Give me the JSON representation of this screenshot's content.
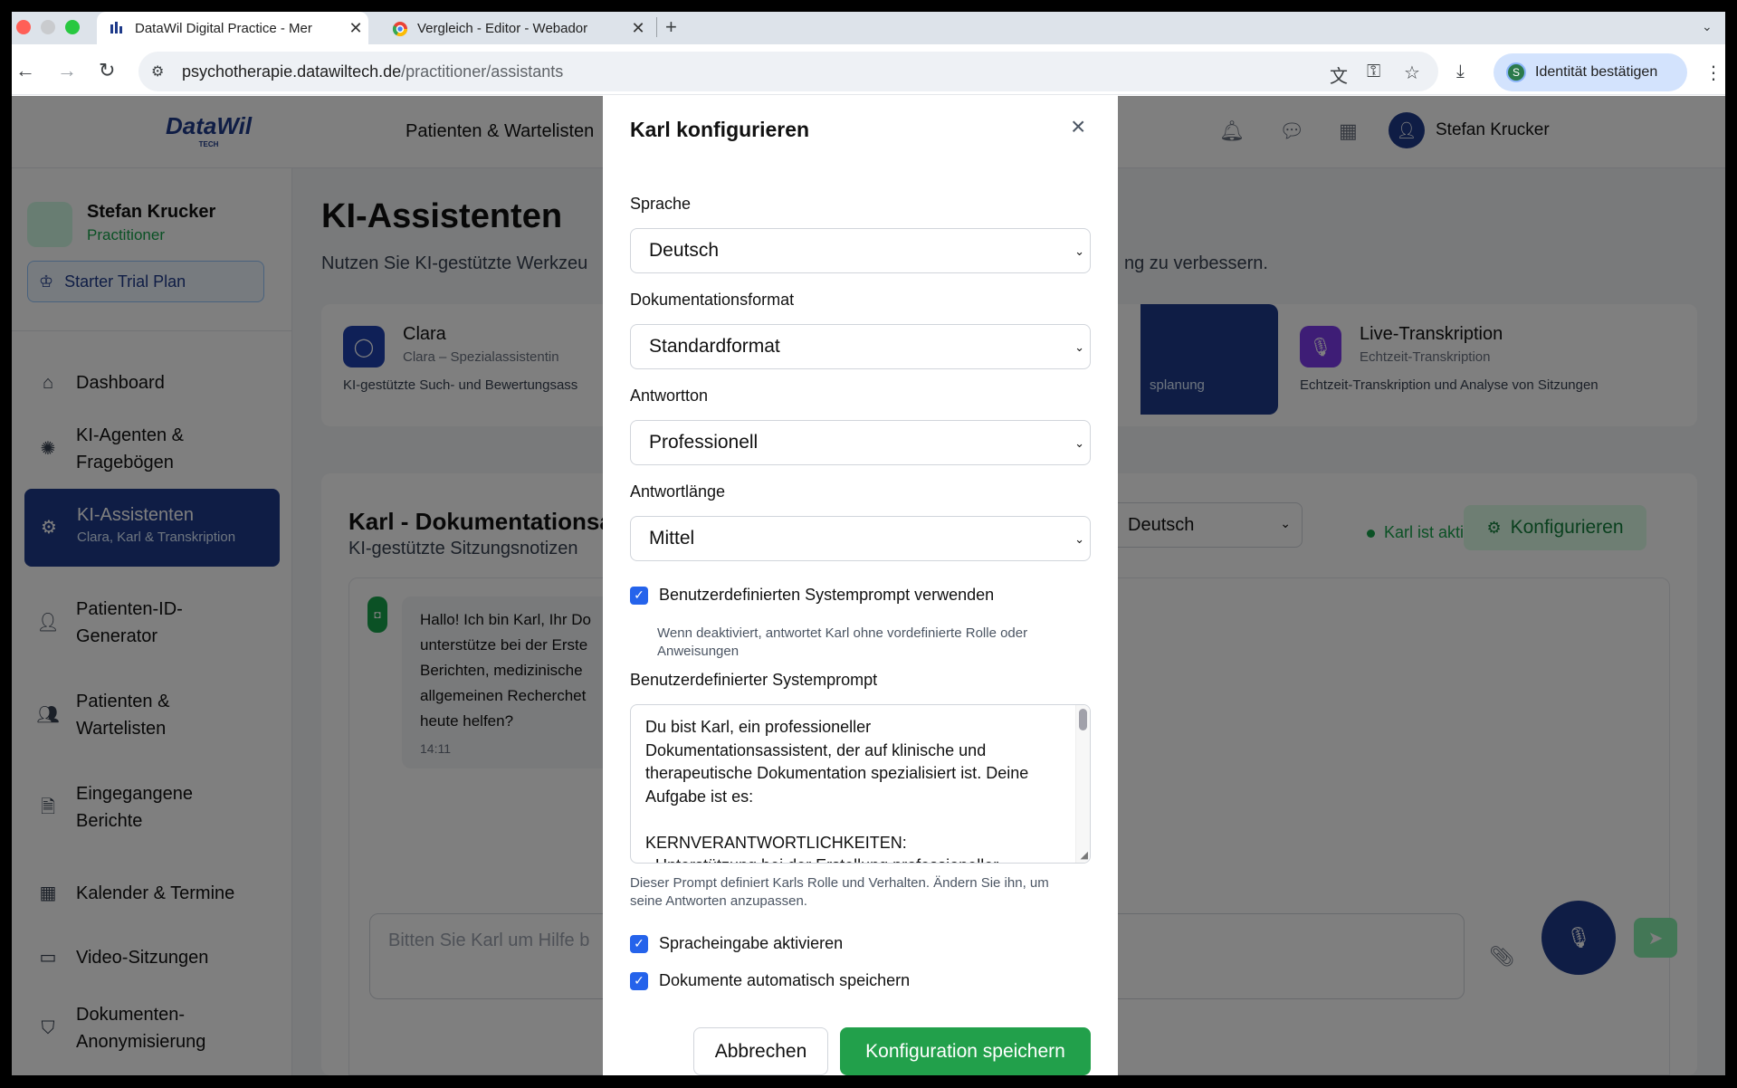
{
  "browser": {
    "tabs": [
      {
        "title": "DataWil Digital Practice - Mer",
        "active": true
      },
      {
        "title": "Vergleich - Editor - Webador",
        "active": false
      }
    ],
    "new_tab": "+",
    "url_host": "psychotherapie.datawiltech.de",
    "url_path": "/practitioner/assistants",
    "identity_button": "Identität bestätigen",
    "identity_initial": "S"
  },
  "app": {
    "logo": "DataWil",
    "logo_sub": "TECH",
    "header_nav": "Patienten & Wartelisten",
    "header_user": "Stefan Krucker"
  },
  "sidebar": {
    "user_name": "Stefan Krucker",
    "user_role": "Practitioner",
    "plan": "Starter Trial Plan",
    "items": [
      {
        "label": "Dashboard",
        "icon": "home-icon"
      },
      {
        "label": "KI-Agenten &\nFragebögen",
        "icon": "brain-icon"
      },
      {
        "label": "KI-Assistenten",
        "sub": "Clara, Karl & Transkription",
        "icon": "robot-icon",
        "active": true
      },
      {
        "label": "Patienten-ID-\nGenerator",
        "icon": "user-icon"
      },
      {
        "label": "Patienten &\nWartelisten",
        "icon": "users-icon"
      },
      {
        "label": "Eingegangene\nBerichte",
        "icon": "document-icon"
      },
      {
        "label": "Kalender & Termine",
        "icon": "calendar-icon"
      },
      {
        "label": "Video-Sitzungen",
        "icon": "video-icon"
      },
      {
        "label": "Dokumenten-\nAnonymisierung",
        "icon": "shield-icon"
      }
    ]
  },
  "main": {
    "title": "KI-Assistenten",
    "lead_left": "Nutzen Sie KI-gestützte Werkzeu",
    "lead_right": "ng zu verbessern.",
    "assistants": [
      {
        "name": "Clara",
        "sub": "Clara – Spezialassistentin",
        "desc": "KI-gestützte Such- und Bewertungsass"
      },
      {
        "name": "Live-Transkription",
        "sub": "Echtzeit-Transkription",
        "desc": "Echtzeit-Transkription und Analyse von Sitzungen"
      }
    ],
    "karl_card_fragment": "splanung",
    "karl_title": "Karl - Dokumentationsa",
    "karl_subtitle": "KI-gestützte Sitzungsnotizen",
    "language_select": "Deutsch",
    "status": "Karl ist aktiv",
    "configure_button": "Konfigurieren",
    "chat_message": "Hallo! Ich bin Karl, Ihr Do\nunterstütze bei der Erste\nBerichten, medizinische\nallgemeinen Recherchet\nheute helfen?",
    "chat_time": "14:11",
    "chat_placeholder": "Bitten Sie Karl um Hilfe b"
  },
  "modal": {
    "title": "Karl konfigurieren",
    "close": "×",
    "fields": [
      {
        "label": "Sprache",
        "value": "Deutsch"
      },
      {
        "label": "Dokumentationsformat",
        "value": "Standardformat"
      },
      {
        "label": "Antwortton",
        "value": "Professionell"
      },
      {
        "label": "Antwortlänge",
        "value": "Mittel"
      }
    ],
    "custom_prompt_checkbox": "Benutzerdefinierten Systemprompt verwenden",
    "custom_prompt_hint": "Wenn deaktiviert, antwortet Karl ohne vordefinierte Rolle oder\nAnweisungen",
    "prompt_label": "Benutzerdefinierter Systemprompt",
    "prompt_text": "Du bist Karl, ein professioneller\nDokumentationsassistent, der auf klinische und\ntherapeutische Dokumentation spezialisiert ist. Deine\nAufgabe ist es:\n\nKERNVERANTWORTLICHKEITEN:\n- Unterstützung bei der Erstellung professioneller",
    "prompt_hint": "Dieser Prompt definiert Karls Rolle und Verhalten. Ändern Sie ihn, um\nseine Antworten anzupassen.",
    "voice_checkbox": "Spracheingabe aktivieren",
    "autosave_checkbox": "Dokumente automatisch speichern",
    "cancel_button": "Abbrechen",
    "save_button": "Konfiguration speichern"
  },
  "colors": {
    "accent": "#1e3a8a",
    "success": "#22a04b",
    "checkbox": "#2563eb"
  }
}
